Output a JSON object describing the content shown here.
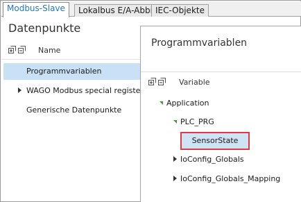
{
  "tabs": [
    {
      "label": "Modbus-Slave",
      "active": true
    },
    {
      "label": "Lokalbus E/A-Abbild",
      "active": false
    },
    {
      "label": "IEC-Objekte",
      "active": false
    }
  ],
  "left_panel": {
    "title": "Datenpunkte",
    "column_header": "Name",
    "items": [
      {
        "label": "Programmvariablen",
        "selected": true,
        "expandable": false
      },
      {
        "label": "WAGO Modbus special register",
        "selected": false,
        "expandable": true
      },
      {
        "label": "Generische Datenpunkte",
        "selected": false,
        "expandable": false
      }
    ]
  },
  "right_panel": {
    "title": "Programmvariablen",
    "column_header": "Variable",
    "tree": {
      "application": "Application",
      "plc_prg": "PLC_PRG",
      "sensor_state": "SensorState",
      "ioconfig_globals": "IoConfig_Globals",
      "ioconfig_globals_mapping": "IoConfig_Globals_Mapping"
    }
  },
  "colors": {
    "active_tab_text": "#1f78c8",
    "selection_background": "#c9e1f7",
    "highlight_border": "#e0393e",
    "expanded_arrow": "#3f9c35"
  },
  "icons": [
    "expand-all-icon",
    "collapse-all-icon"
  ]
}
